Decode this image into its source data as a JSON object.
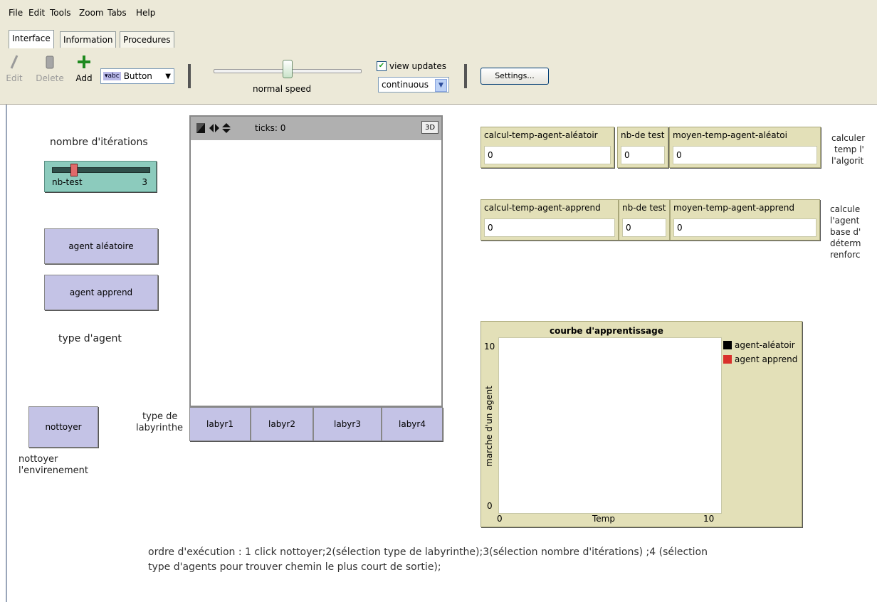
{
  "menu": [
    "File",
    "Edit",
    "Tools",
    "Zoom",
    "Tabs",
    "Help"
  ],
  "tabs": [
    "Interface",
    "Information",
    "Procedures"
  ],
  "toolbar": {
    "edit": "Edit",
    "delete": "Delete",
    "add": "Add",
    "widget_type": "Button",
    "speed_label": "normal speed",
    "speed": 0.5,
    "view_updates_label": "view updates",
    "view_updates_checked": true,
    "update_mode": "continuous",
    "settings_label": "Settings..."
  },
  "labels": {
    "iterations": "nombre d'itérations",
    "agent_type": "type d'agent",
    "maze_type_1": "type de",
    "maze_type_2": "labyrinthe",
    "clean_1": "nottoyer",
    "clean_2": "l'envirenement"
  },
  "slider": {
    "name": "nb-test",
    "value": "3"
  },
  "buttons": {
    "agent_random": "agent aléatoire",
    "agent_learn": "agent apprend",
    "clean": "nottoyer",
    "labyr1": "labyr1",
    "labyr2": "labyr2",
    "labyr3": "labyr3",
    "labyr4": "labyr4"
  },
  "view": {
    "ticks": "ticks: 0",
    "btn3d": "3D"
  },
  "monitors": [
    {
      "label": "calcul-temp-agent-aléatoir",
      "value": "0"
    },
    {
      "label": "nb-de test",
      "value": "0"
    },
    {
      "label": "moyen-temp-agent-aléatoi",
      "value": "0"
    },
    {
      "label": "calcul-temp-agent-apprend",
      "value": "0"
    },
    {
      "label": "nb-de test",
      "value": "0"
    },
    {
      "label": "moyen-temp-agent-apprend",
      "value": "0"
    }
  ],
  "notes": {
    "right1": [
      "calculer",
      "temp l'",
      "l'algorit"
    ],
    "right2": [
      "calcule",
      "l'agent",
      "base d'",
      "déterm",
      "renforc"
    ],
    "bottom_1": "ordre d'exécution : 1 click nottoyer;2(sélection type de labyrinthe);3(sélection nombre d'itérations) ;4 (sélection",
    "bottom_2": "type d'agents pour trouver chemin le plus court de sortie);"
  },
  "chart_data": {
    "type": "line",
    "title": "courbe d'apprentissage",
    "xlabel": "Temp",
    "ylabel": "marche d'un agent",
    "xlim": [
      0,
      10
    ],
    "ylim": [
      0,
      10
    ],
    "x_ticks": [
      "0",
      "10"
    ],
    "y_ticks": [
      "0",
      "10"
    ],
    "series": [
      {
        "name": "agent-aléatoir",
        "color": "#000000",
        "x": [],
        "y": []
      },
      {
        "name": "agent apprend",
        "color": "#d9302b",
        "x": [],
        "y": []
      }
    ]
  }
}
